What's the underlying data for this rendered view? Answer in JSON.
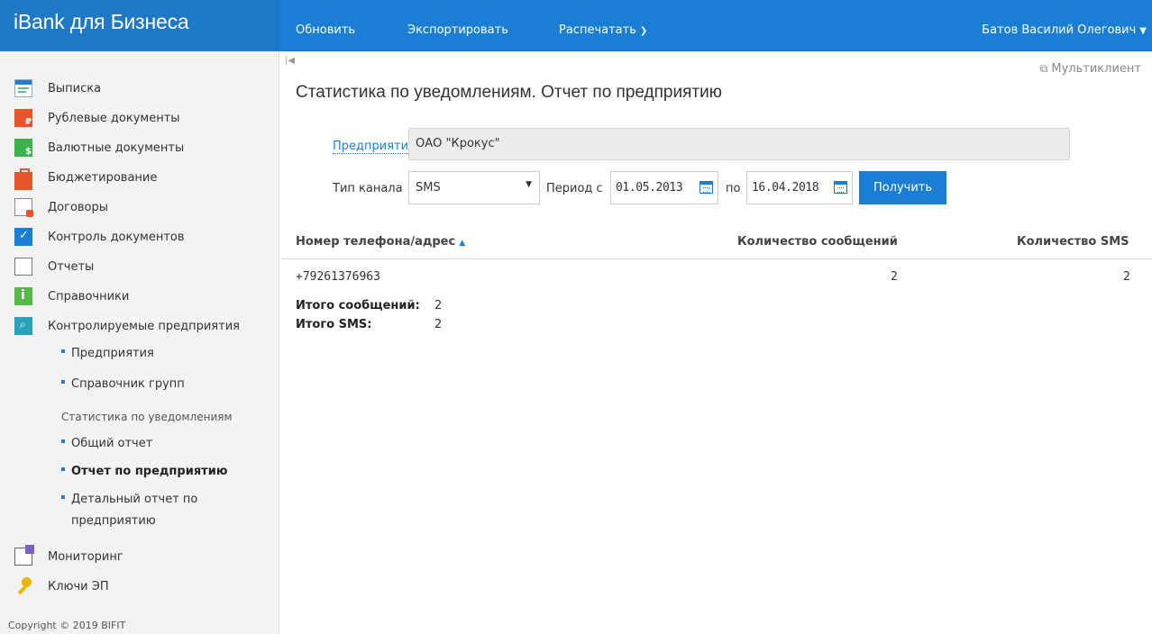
{
  "header": {
    "brand": "iBank для Бизнеса",
    "menu": [
      {
        "label": "Обновить"
      },
      {
        "label": "Экспортировать"
      },
      {
        "label": "Распечатать"
      }
    ],
    "user": "Батов Василий Олегович"
  },
  "sidebar": {
    "items": [
      {
        "label": "Выписка",
        "icon": "statement-icon"
      },
      {
        "label": "Рублевые документы",
        "icon": "ruble-documents-icon"
      },
      {
        "label": "Валютные документы",
        "icon": "currency-documents-icon"
      },
      {
        "label": "Бюджетирование",
        "icon": "briefcase-icon"
      },
      {
        "label": "Договоры",
        "icon": "contract-icon"
      },
      {
        "label": "Контроль документов",
        "icon": "check-document-icon"
      },
      {
        "label": "Отчеты",
        "icon": "report-icon"
      },
      {
        "label": "Справочники",
        "icon": "info-icon"
      },
      {
        "label": "Контролируемые предприятия",
        "icon": "search-document-icon"
      }
    ],
    "subitems": [
      {
        "label": "Предприятия"
      },
      {
        "label": "Справочник групп"
      }
    ],
    "section_title": "Статистика по уведомлениям",
    "stats_items": [
      {
        "label": "Общий отчет"
      },
      {
        "label": "Отчет по предприятию"
      },
      {
        "label": "Детальный отчет по"
      },
      {
        "label": "предприятию"
      }
    ],
    "bottom_items": [
      {
        "label": "Мониторинг",
        "icon": "monitoring-icon"
      },
      {
        "label": "Ключи ЭП",
        "icon": "key-icon"
      }
    ],
    "copyright": "Copyright © 2019 BIFIT"
  },
  "main": {
    "multiclient": "Мультиклиент",
    "title": "Статистика по уведомлениям. Отчет по предприятию",
    "org_label": "Предприятие",
    "org_value": "ОАО \"Крокус\"",
    "channel_label": "Тип канала",
    "channel_value": "SMS",
    "period_label": "Период с",
    "date_from": "01.05.2013",
    "to_label": "по",
    "date_to": "16.04.2018",
    "submit": "Получить",
    "table": {
      "headers": [
        "Номер телефона/адрес",
        "Количество сообщений",
        "Количество SMS"
      ],
      "rows": [
        [
          "+79261376963",
          "2",
          "2"
        ]
      ]
    },
    "totals": {
      "messages_label": "Итого сообщений:",
      "messages_value": "2",
      "sms_label": "Итого SMS:",
      "sms_value": "2"
    }
  },
  "colors": {
    "accent": "#1a7fd4",
    "sidebar_bg": "#f3f3f3"
  }
}
